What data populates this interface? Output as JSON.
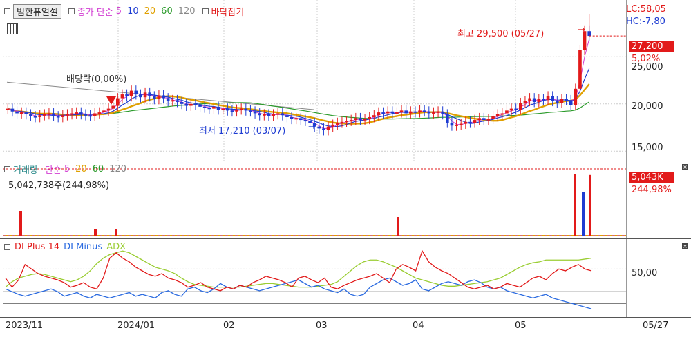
{
  "header": {
    "title": "범한퓨얼셀",
    "ma_label": "종가 단순",
    "periods": [
      "5",
      "10",
      "20",
      "60",
      "120"
    ],
    "period_colors": [
      "#d23cd2",
      "#1e3cd2",
      "#e0a000",
      "#2a9a2a",
      "#888888"
    ],
    "bottom_label": "바닥잡기",
    "lc": "LC:58,05",
    "hc": "HC:-7,80"
  },
  "price": {
    "high_label": "최고 29,500 (05/27)",
    "low_label": "최저 17,210 (03/07)",
    "dividend_label": "배당락(0,00%)",
    "current_price": "27,200",
    "current_change": "5,02%",
    "axis_ticks": [
      "25,000",
      "20,000",
      "15,000"
    ]
  },
  "volume": {
    "title": "거래량",
    "ma_label": "단순",
    "periods": [
      "5",
      "20",
      "60",
      "120"
    ],
    "period_colors": [
      "#d23cd2",
      "#e0a000",
      "#2a9a2a",
      "#888888"
    ],
    "info": "5,042,738주(244,98%)",
    "current": "5,043K",
    "current_pct": "244,98%"
  },
  "dmi": {
    "plus_label": "DI Plus 14",
    "minus_label": "DI Minus",
    "adx_label": "ADX",
    "axis_tick": "50,00",
    "colors": {
      "plus": "#e21a1a",
      "minus": "#2a6ae0",
      "adx": "#9acd32"
    }
  },
  "x_axis": {
    "labels": [
      "2023/11",
      "2024/01",
      "02",
      "03",
      "04",
      "05"
    ],
    "last_date": "05/27"
  },
  "chart_data": {
    "type": "line",
    "title": "범한퓨얼셀",
    "price_series": [
      19500,
      19200,
      19000,
      19100,
      18900,
      18700,
      18600,
      18800,
      18900,
      19000,
      18700,
      18600,
      18800,
      18900,
      19000,
      19100,
      18900,
      18800,
      18700,
      19000,
      19100,
      19300,
      19500,
      19800,
      20600,
      21000,
      20800,
      21400,
      21000,
      20700,
      21200,
      20800,
      20500,
      20900,
      20600,
      20300,
      20400,
      20200,
      20000,
      19800,
      20000,
      19900,
      19700,
      19600,
      19500,
      19700,
      19400,
      19500,
      19300,
      19200,
      19400,
      19500,
      19300,
      19200,
      19000,
      18800,
      18900,
      18700,
      18900,
      19000,
      18800,
      18600,
      18400,
      18500,
      18300,
      18200,
      18000,
      17600,
      17400,
      17210,
      17600,
      17800,
      18000,
      18100,
      18200,
      18300,
      18500,
      18300,
      18400,
      18600,
      18800,
      19100,
      19000,
      19200,
      19000,
      19100,
      19300,
      19000,
      19200,
      19100,
      19300,
      19200,
      19000,
      19100,
      19200,
      18900,
      18000,
      17700,
      17800,
      17900,
      18100,
      18000,
      18300,
      18500,
      18300,
      18400,
      18700,
      18900,
      19000,
      19300,
      19500,
      19400,
      20100,
      20300,
      20600,
      20200,
      20500,
      20400,
      20800,
      20300,
      20100,
      20500,
      20400,
      19900,
      21600,
      25700,
      27700,
      27200
    ],
    "y_range": [
      14000,
      31000
    ],
    "high": {
      "value": 29500,
      "date": "05/27"
    },
    "low": {
      "value": 17210,
      "date": "03/07"
    },
    "volume_spikes": [
      {
        "index": 11,
        "pct": 40
      },
      {
        "index": 65,
        "pct": 10
      },
      {
        "index": 80,
        "pct": 10
      },
      {
        "index": 284,
        "pct": 30
      },
      {
        "index": 412,
        "pct": 100
      },
      {
        "index": 418,
        "pct": 70
      },
      {
        "index": 423,
        "pct": 98
      }
    ],
    "di_plus": [
      40,
      30,
      38,
      55,
      50,
      45,
      42,
      40,
      38,
      35,
      30,
      32,
      35,
      30,
      28,
      40,
      62,
      68,
      62,
      58,
      52,
      48,
      44,
      42,
      45,
      40,
      38,
      35,
      30,
      32,
      35,
      30,
      28,
      26,
      30,
      28,
      32,
      30,
      35,
      38,
      42,
      40,
      38,
      35,
      30,
      40,
      42,
      38,
      35,
      40,
      30,
      28,
      32,
      35,
      38,
      40,
      42,
      45,
      40,
      35,
      50,
      55,
      52,
      48,
      70,
      58,
      52,
      48,
      45,
      40,
      35,
      30,
      28,
      30,
      32,
      28,
      30,
      34,
      32,
      30,
      35,
      40,
      42,
      38,
      45,
      50,
      48,
      52,
      55,
      50,
      48
    ],
    "di_minus": [
      28,
      25,
      22,
      20,
      22,
      24,
      26,
      28,
      25,
      20,
      22,
      24,
      20,
      18,
      22,
      20,
      18,
      20,
      22,
      24,
      20,
      22,
      20,
      18,
      24,
      26,
      22,
      20,
      28,
      30,
      26,
      24,
      28,
      34,
      30,
      28,
      32,
      30,
      28,
      26,
      28,
      30,
      32,
      34,
      36,
      38,
      34,
      30,
      32,
      28,
      26,
      24,
      28,
      22,
      20,
      22,
      30,
      34,
      38,
      40,
      36,
      32,
      34,
      38,
      28,
      26,
      30,
      34,
      36,
      34,
      32,
      36,
      38,
      35,
      30,
      28,
      30,
      26,
      24,
      22,
      20,
      18,
      20,
      22,
      18,
      16,
      14,
      12,
      10,
      8,
      6
    ],
    "adx": [
      30,
      36,
      40,
      42,
      44,
      45,
      44,
      42,
      40,
      38,
      36,
      38,
      42,
      48,
      56,
      62,
      66,
      68,
      70,
      68,
      64,
      60,
      56,
      52,
      50,
      48,
      45,
      40,
      36,
      33,
      32,
      31,
      30,
      30,
      30,
      30,
      30,
      31,
      32,
      33,
      34,
      34,
      33,
      32,
      31,
      30,
      30,
      30,
      31,
      32,
      33,
      36,
      42,
      48,
      54,
      58,
      60,
      60,
      58,
      55,
      52,
      48,
      44,
      40,
      38,
      36,
      34,
      32,
      31,
      31,
      32,
      33,
      34,
      35,
      36,
      38,
      40,
      44,
      48,
      52,
      55,
      57,
      58,
      60,
      60,
      60,
      60,
      60,
      60,
      61,
      62
    ],
    "x_labels": [
      "2023/11",
      "2024/01",
      "02",
      "03",
      "04",
      "05"
    ],
    "price_ticks": [
      25000,
      20000,
      15000
    ],
    "dmi_tick": 50
  }
}
